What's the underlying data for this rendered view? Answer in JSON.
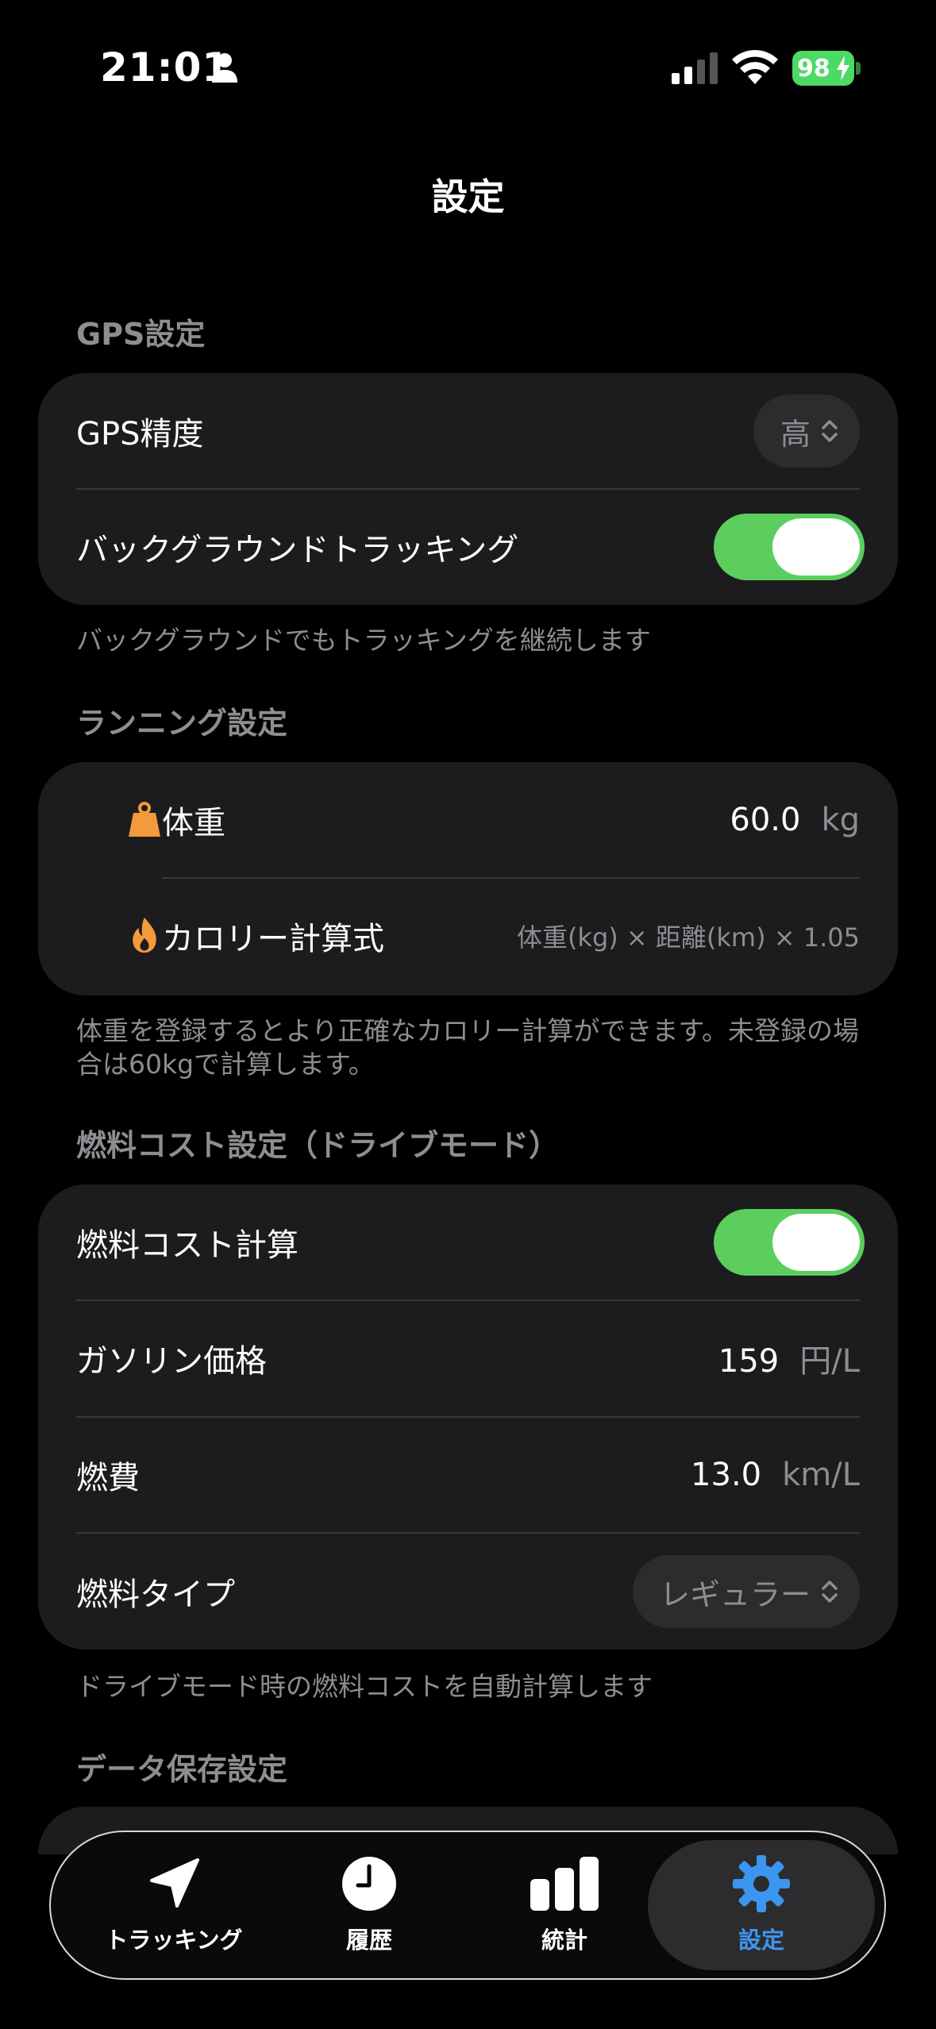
{
  "status_bar": {
    "time": "21:01",
    "battery": "98"
  },
  "nav": {
    "title": "設定"
  },
  "sections": {
    "gps": {
      "header": "GPS設定",
      "accuracy_label": "GPS精度",
      "accuracy_value": "高",
      "background_label": "バックグラウンドトラッキング",
      "background_on": true,
      "footer": "バックグラウンドでもトラッキングを継続します"
    },
    "running": {
      "header": "ランニング設定",
      "weight_label": "体重",
      "weight_value": "60.0",
      "weight_unit": "kg",
      "calorie_label": "カロリー計算式",
      "calorie_formula": "体重(kg) × 距離(km) × 1.05",
      "footer": "体重を登録するとより正確なカロリー計算ができます。未登録の場合は60kgで計算します。"
    },
    "fuel": {
      "header": "燃料コスト設定（ドライブモード）",
      "cost_calc_label": "燃料コスト計算",
      "cost_calc_on": true,
      "gas_price_label": "ガソリン価格",
      "gas_price_value": "159",
      "gas_price_unit": "円/L",
      "efficiency_label": "燃費",
      "efficiency_value": "13.0",
      "efficiency_unit": "km/L",
      "fuel_type_label": "燃料タイプ",
      "fuel_type_value": "レギュラー",
      "footer": "ドライブモード時の燃料コストを自動計算します"
    },
    "data": {
      "header": "データ保存設定"
    }
  },
  "tabs": [
    {
      "label": "トラッキング",
      "icon": "location-arrow-icon"
    },
    {
      "label": "履歴",
      "icon": "clock-icon"
    },
    {
      "label": "統計",
      "icon": "bar-chart-icon"
    },
    {
      "label": "設定",
      "icon": "gear-icon"
    }
  ],
  "colors": {
    "background": "#000000",
    "card": "#1c1c1e",
    "toggle_on": "#5bce5e",
    "accent": "#3c95f0",
    "icon_orange": "#f39a3c"
  }
}
